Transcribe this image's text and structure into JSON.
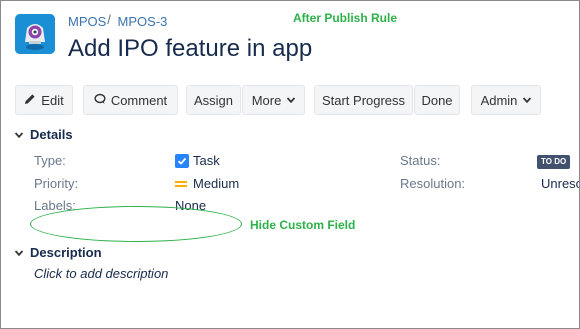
{
  "header": {
    "project": "MPOS",
    "separator": "/",
    "issue_key": "MPOS-3",
    "title": "Add IPO feature in app",
    "avatar_icon": "project-avatar-icon"
  },
  "annotations": {
    "top_note": "After Publish Rule",
    "hide_note": "Hide Custom Field",
    "color": "#2db24a"
  },
  "toolbar": {
    "edit": "Edit",
    "comment": "Comment",
    "assign": "Assign",
    "more": "More",
    "start_progress": "Start Progress",
    "done": "Done",
    "admin": "Admin"
  },
  "details": {
    "heading": "Details",
    "type_label": "Type:",
    "type_value": "Task",
    "priority_label": "Priority:",
    "priority_value": "Medium",
    "labels_label": "Labels:",
    "labels_value": "None",
    "status_label": "Status:",
    "status_value": "TO DO",
    "resolution_label": "Resolution:",
    "resolution_value": "Unreso"
  },
  "description": {
    "heading": "Description",
    "placeholder": "Click to add description"
  },
  "colors": {
    "link": "#3b73af",
    "accent": "#2684ff",
    "priority_medium": "#ffab00",
    "status_lozenge": "#42526e"
  }
}
